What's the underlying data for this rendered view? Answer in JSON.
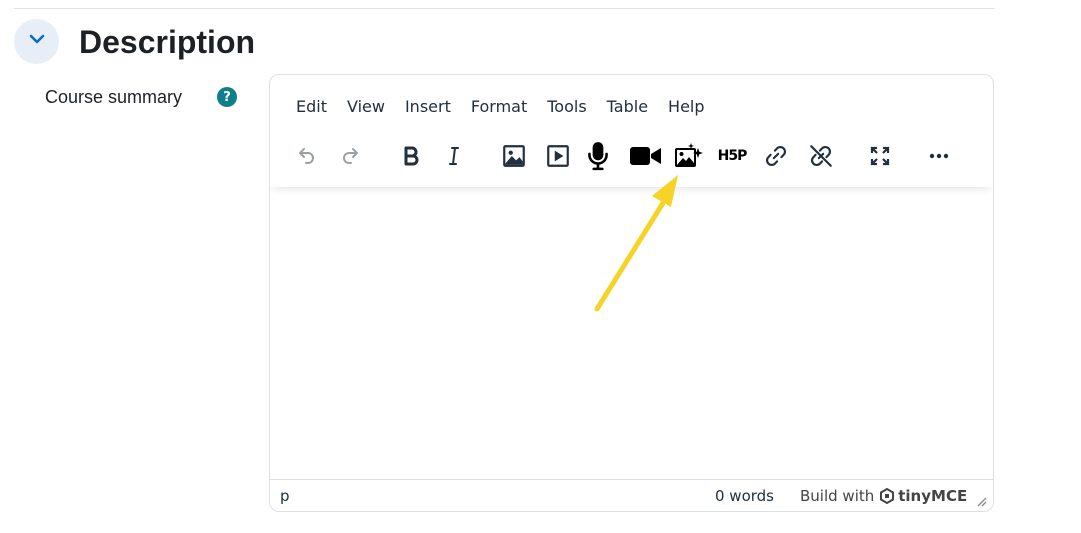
{
  "section": {
    "title": "Description",
    "collapse_icon": "chevron-down-icon",
    "accent_color": "#0f6cbf"
  },
  "field": {
    "label": "Course summary",
    "help_icon_glyph": "?",
    "help_color": "#0f7f8c"
  },
  "editor": {
    "menu": [
      "Edit",
      "View",
      "Insert",
      "Format",
      "Tools",
      "Table",
      "Help"
    ],
    "toolbar": [
      {
        "name": "undo-icon",
        "enabled": false
      },
      {
        "name": "redo-icon",
        "enabled": false
      },
      {
        "name": "bold-icon",
        "enabled": true
      },
      {
        "name": "italic-icon",
        "enabled": true
      },
      {
        "name": "image-icon",
        "enabled": true
      },
      {
        "name": "media-icon",
        "enabled": true
      },
      {
        "name": "record-audio-icon",
        "enabled": true
      },
      {
        "name": "record-video-icon",
        "enabled": true
      },
      {
        "name": "ai-image-icon",
        "enabled": true
      },
      {
        "name": "h5p-icon",
        "enabled": true
      },
      {
        "name": "link-icon",
        "enabled": true
      },
      {
        "name": "unlink-icon",
        "enabled": true
      },
      {
        "name": "fullscreen-icon",
        "enabled": true
      },
      {
        "name": "more-icon",
        "enabled": true
      }
    ],
    "h5p_label": "H5P",
    "status": {
      "path": "p",
      "word_count": "0 words",
      "build_with": "Build with",
      "brand": "tinyMCE"
    }
  },
  "annotation": {
    "arrow_color": "#f5d327",
    "points_to": "ai-image-icon"
  }
}
